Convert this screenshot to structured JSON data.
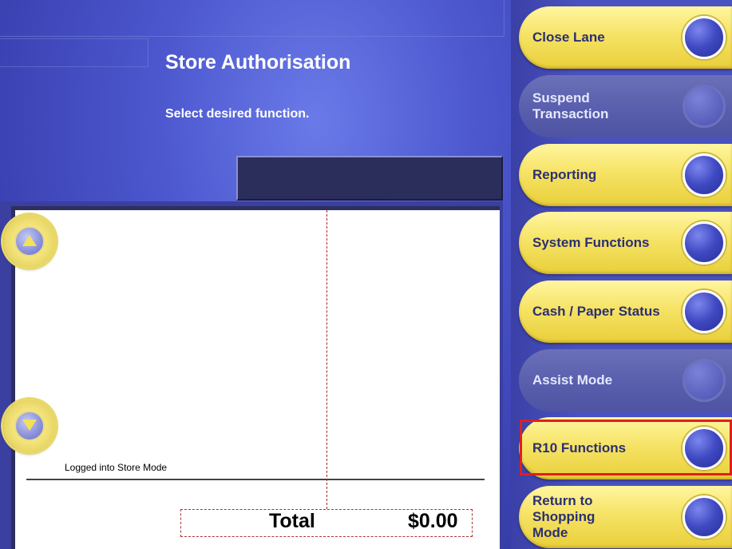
{
  "screen": {
    "title": "Store Authorisation",
    "instruction": "Select desired function."
  },
  "receipt": {
    "status_line": "Logged into Store Mode",
    "total_label": "Total",
    "total_value": "$0.00"
  },
  "menu": {
    "items": [
      {
        "label": "Close Lane",
        "enabled": true
      },
      {
        "label": "Suspend Transaction",
        "enabled": false
      },
      {
        "label": "Reporting",
        "enabled": true
      },
      {
        "label": "System Functions",
        "enabled": true
      },
      {
        "label": "Cash / Paper Status",
        "enabled": true
      },
      {
        "label": "Assist Mode",
        "enabled": false
      },
      {
        "label": "R10 Functions",
        "enabled": true,
        "highlighted": true
      },
      {
        "label": "Return to Shopping Mode",
        "enabled": true
      }
    ]
  },
  "colors": {
    "background_blue": "#4a52c0",
    "button_yellow": "#f6e366",
    "button_text": "#2b2f72",
    "highlight_red": "#e01e1e"
  },
  "icons": {
    "scroll_up": "triangle-up-icon",
    "scroll_down": "triangle-down-icon",
    "menu_knob": "round-button-icon"
  }
}
